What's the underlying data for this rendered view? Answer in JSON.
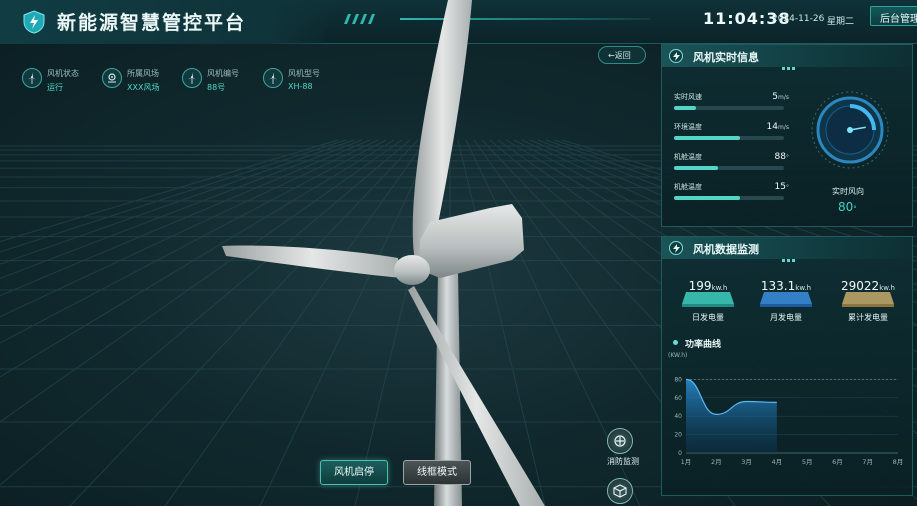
{
  "header": {
    "title": "新能源智慧管控平台",
    "time": "11:04:38",
    "date": "2024-11-26",
    "weekday": "星期二",
    "admin_label": "后台管理",
    "accent": "#2fb7b0"
  },
  "info": [
    {
      "label": "风机状态",
      "value": "运行",
      "icon": "turbine-icon"
    },
    {
      "label": "所属风场",
      "value": "XXX风场",
      "icon": "location-icon"
    },
    {
      "label": "风机编号",
      "value": "88号",
      "icon": "turbine-icon"
    },
    {
      "label": "风机型号",
      "value": "XH-88",
      "icon": "turbine-icon"
    }
  ],
  "back_label": "返回",
  "controls": {
    "start_stop": "风机启停",
    "wireframe": "线框模式",
    "fire_monitor": "消防监测"
  },
  "realtime": {
    "title": "风机实时信息",
    "rows": [
      {
        "label": "实时风速",
        "value": "5",
        "unit": "m/s",
        "level": 0.2
      },
      {
        "label": "环境温度",
        "value": "14",
        "unit": "m/s",
        "level": 0.6
      },
      {
        "label": "机舱温度",
        "value": "88",
        "unit": "°",
        "level": 0.4
      },
      {
        "label": "机舱温度",
        "value": "15",
        "unit": "°",
        "level": 0.6
      }
    ],
    "wind_direction_label": "实时风向",
    "wind_direction_value": "80",
    "wind_direction_unit": "°"
  },
  "monitor": {
    "title": "风机数据监测",
    "energy": [
      {
        "value": "199",
        "unit": "kw.h",
        "label": "日发电量",
        "color": "#3fd0c0"
      },
      {
        "value": "133.1",
        "unit": "kw.h",
        "label": "月发电量",
        "color": "#3c8fe0"
      },
      {
        "value": "29022",
        "unit": "kw.h",
        "label": "累计发电量",
        "color": "#c8aa6a"
      }
    ],
    "power_title": "功率曲线"
  },
  "chart_data": {
    "type": "area",
    "ylabel": "(KW.h)",
    "categories": [
      "1月",
      "2月",
      "3月",
      "4月",
      "5月",
      "6月",
      "7月",
      "8月"
    ],
    "series": [
      {
        "values": [
          80,
          42,
          56,
          55,
          null,
          null,
          null,
          null
        ]
      }
    ],
    "y_ticks": [
      0,
      20,
      40,
      60,
      80
    ],
    "ylim": [
      0,
      100
    ],
    "reference_line": 80
  }
}
